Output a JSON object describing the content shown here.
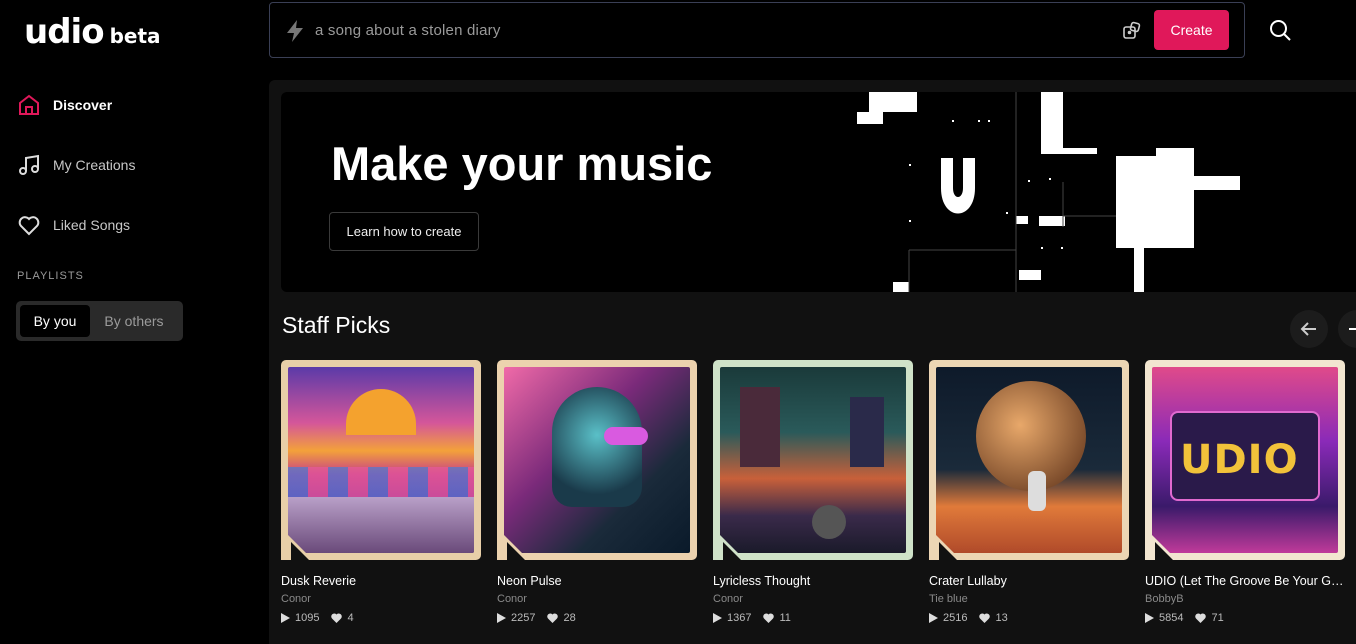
{
  "brand": {
    "name": "udio",
    "badge": "beta"
  },
  "sidebar": {
    "items": [
      {
        "label": "Discover",
        "icon": "home-icon",
        "active": true
      },
      {
        "label": "My Creations",
        "icon": "music-note-icon"
      },
      {
        "label": "Liked Songs",
        "icon": "heart-icon"
      }
    ],
    "playlists_heading": "PLAYLISTS",
    "playlist_tabs": [
      {
        "label": "By you",
        "selected": true
      },
      {
        "label": "By others"
      }
    ]
  },
  "search": {
    "placeholder": "a song about a stolen diary",
    "create_label": "Create"
  },
  "hero": {
    "title": "Make your music",
    "cta": "Learn how to create"
  },
  "staff_picks": {
    "heading": "Staff Picks",
    "cards": [
      {
        "title": "Dusk Reverie",
        "author": "Conor",
        "plays": "1095",
        "likes": "4"
      },
      {
        "title": "Neon Pulse",
        "author": "Conor",
        "plays": "2257",
        "likes": "28"
      },
      {
        "title": "Lyricless Thought",
        "author": "Conor",
        "plays": "1367",
        "likes": "11"
      },
      {
        "title": "Crater Lullaby",
        "author": "Tie blue",
        "plays": "2516",
        "likes": "13"
      },
      {
        "title": "UDIO (Let The Groove Be Your Guide)",
        "author": "BobbyB",
        "plays": "5854",
        "likes": "71"
      }
    ]
  },
  "colors": {
    "accent": "#e0185a",
    "background": "#000000",
    "panel": "#111111"
  }
}
